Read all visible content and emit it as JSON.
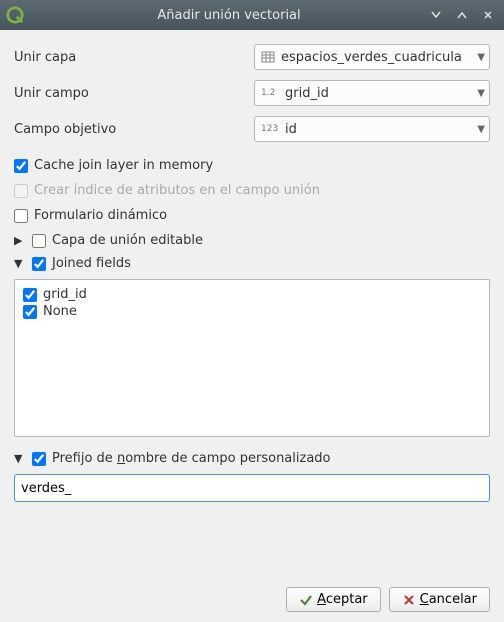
{
  "window": {
    "title": "Añadir unión vectorial"
  },
  "form": {
    "join_layer_label": "Unir capa",
    "join_layer_value": "espacios_verdes_cuadricula",
    "join_field_label": "Unir campo",
    "join_field_value": "grid_id",
    "join_field_type": "1.2",
    "target_field_label": "Campo objetivo",
    "target_field_value": "id",
    "target_field_type": "123"
  },
  "checks": {
    "cache_label": "Cache join layer in memory",
    "cache_checked": true,
    "create_index_label": "Crear índice de atributos en el campo unión",
    "create_index_checked": false,
    "create_index_enabled": false,
    "dynamic_form_label": "Formulario dinámico",
    "dynamic_form_checked": false
  },
  "sections": {
    "editable_layer": {
      "label": "Capa de unión editable",
      "expanded": false,
      "checked": false
    },
    "joined_fields": {
      "label": "Joined fields",
      "expanded": true,
      "checked": true,
      "items": [
        {
          "label": "grid_id",
          "checked": true
        },
        {
          "label": "None",
          "checked": true
        }
      ]
    },
    "custom_prefix": {
      "label": "Prefijo de nombre de campo personalizado",
      "expanded": true,
      "checked": true,
      "value": "verdes_"
    }
  },
  "buttons": {
    "ok": "Aceptar",
    "cancel": "Cancelar"
  },
  "icons": {
    "minimize": "min",
    "maximize": "max",
    "close": "close"
  }
}
